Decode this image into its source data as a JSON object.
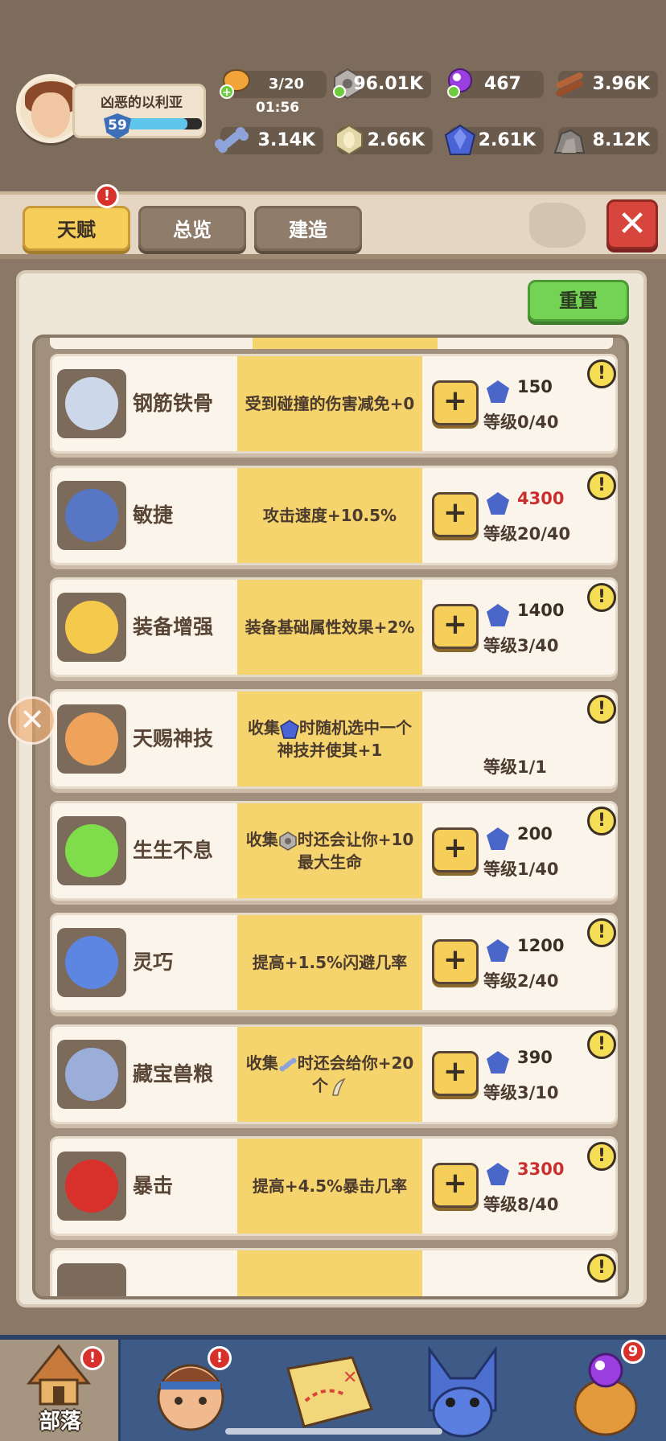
{
  "player": {
    "name": "凶恶的以利亚",
    "level": "59",
    "xp_fraction": 0.8
  },
  "resources": {
    "energy": {
      "value": "3/20",
      "timer": "01:56"
    },
    "stone": {
      "value": "96.01K"
    },
    "orb": {
      "value": "467"
    },
    "wood": {
      "value": "3.96K"
    },
    "bone": {
      "value": "3.14K"
    },
    "tooth": {
      "value": "2.66K"
    },
    "gem": {
      "value": "2.61K"
    },
    "rock": {
      "value": "8.12K"
    }
  },
  "tabs": [
    {
      "label": "天赋",
      "active": true,
      "badge": "!"
    },
    {
      "label": "总览",
      "active": false
    },
    {
      "label": "建造",
      "active": false
    }
  ],
  "close_label": "✕",
  "reset_label": "重置",
  "talents": [
    {
      "icon": "shield-bird-icon",
      "title": "钢筋铁骨",
      "desc": "受到碰撞的伤害减免+0",
      "cost": "150",
      "cost_red": false,
      "level": "等级0/40",
      "upgrade": true
    },
    {
      "icon": "spear-icon",
      "title": "敏捷",
      "desc": "攻击速度+10.5%",
      "cost": "4300",
      "cost_red": true,
      "level": "等级20/40",
      "upgrade": true
    },
    {
      "icon": "armor-up-icon",
      "title": "装备增强",
      "desc": "装备基础属性效果+2%",
      "cost": "1400",
      "cost_red": false,
      "level": "等级3/40",
      "upgrade": true
    },
    {
      "icon": "praying-hands-icon",
      "title": "天赐神技",
      "desc_a": "收集",
      "desc_b": "时随机选中一个神技并使其+1",
      "level": "等级1/1",
      "upgrade": false
    },
    {
      "icon": "heart-icon",
      "title": "生生不息",
      "desc_a": "收集",
      "desc_b": "时还会让你+10最大生命",
      "cost": "200",
      "cost_red": false,
      "level": "等级1/40",
      "upgrade": true
    },
    {
      "icon": "dash-icon",
      "title": "灵巧",
      "desc": "提高+1.5%闪避几率",
      "cost": "1200",
      "cost_red": false,
      "level": "等级2/40",
      "upgrade": true
    },
    {
      "icon": "bone-icon",
      "title": "藏宝兽粮",
      "desc_a": "收集",
      "desc_b": "时还会给你+20个",
      "cost": "390",
      "cost_red": false,
      "level": "等级3/10",
      "upgrade": true
    },
    {
      "icon": "fist-icon",
      "title": "暴击",
      "desc": "提高+4.5%暴击几率",
      "cost": "3300",
      "cost_red": true,
      "level": "等级8/40",
      "upgrade": true
    }
  ],
  "info_label": "!",
  "plus_label": "+",
  "bottom_nav": [
    {
      "label": "部落",
      "active": true,
      "badge": "!"
    },
    {
      "label": "",
      "active": false,
      "badge": "!"
    },
    {
      "label": "",
      "active": false
    },
    {
      "label": "",
      "active": false
    },
    {
      "label": "",
      "active": false,
      "badge": "9"
    }
  ]
}
